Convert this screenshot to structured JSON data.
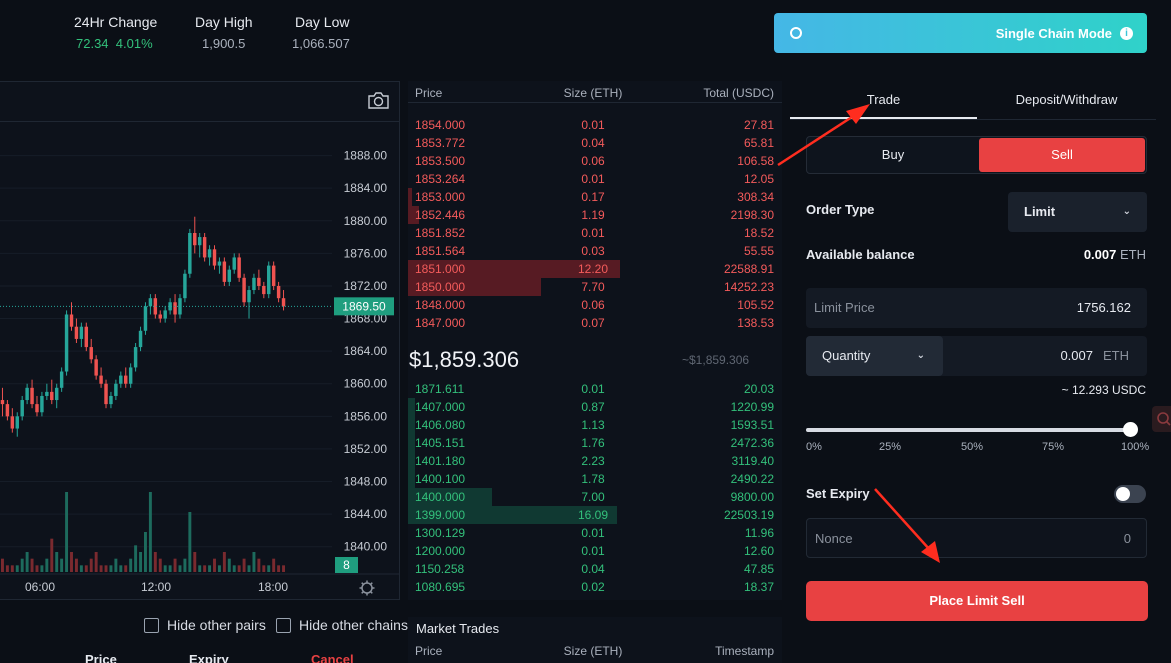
{
  "header": {
    "stats": [
      {
        "label": "24Hr Change",
        "value": "72.34",
        "extra": "4.01%"
      },
      {
        "label": "Day High",
        "value": "1,900.5"
      },
      {
        "label": "Day Low",
        "value": "1,066.507"
      }
    ],
    "mode_button": {
      "label": "Single Chain Mode",
      "info_glyph": "i",
      "ring_icon": "circle-ring-icon",
      "info_icon": "info-icon"
    }
  },
  "chart": {
    "toolbar_icon": "camera-icon",
    "last_price_label": "1869.50",
    "volume_badge": "8",
    "settings_icon": "gear-icon"
  },
  "chart_data": {
    "type": "candlestick",
    "ylim": [
      1838,
      1892
    ],
    "y_ticks": [
      "1888.00",
      "1884.00",
      "1880.00",
      "1876.00",
      "1872.00",
      "1868.00",
      "1864.00",
      "1860.00",
      "1856.00",
      "1852.00",
      "1848.00",
      "1844.00",
      "1840.00"
    ],
    "x_ticks": [
      "06:00",
      "12:00",
      "18:00"
    ],
    "last_price": 1869.5,
    "candles": [
      [
        1858.0,
        1859.5,
        1856.0,
        1857.5
      ],
      [
        1857.5,
        1858.0,
        1855.5,
        1856.0
      ],
      [
        1856.0,
        1857.0,
        1854.0,
        1854.5
      ],
      [
        1854.5,
        1856.5,
        1853.5,
        1856.0
      ],
      [
        1856.0,
        1858.5,
        1855.5,
        1858.0
      ],
      [
        1858.0,
        1860.0,
        1857.5,
        1859.5
      ],
      [
        1859.5,
        1860.5,
        1857.0,
        1857.5
      ],
      [
        1857.5,
        1858.5,
        1856.0,
        1856.5
      ],
      [
        1856.5,
        1859.0,
        1856.0,
        1858.5
      ],
      [
        1858.5,
        1860.0,
        1858.0,
        1859.0
      ],
      [
        1859.0,
        1860.5,
        1857.5,
        1858.0
      ],
      [
        1858.0,
        1860.0,
        1857.0,
        1859.5
      ],
      [
        1859.5,
        1862.0,
        1859.0,
        1861.5
      ],
      [
        1861.5,
        1869.0,
        1861.0,
        1868.5
      ],
      [
        1868.5,
        1870.0,
        1866.5,
        1867.0
      ],
      [
        1867.0,
        1868.0,
        1865.0,
        1865.5
      ],
      [
        1865.5,
        1867.5,
        1864.5,
        1867.0
      ],
      [
        1867.0,
        1867.5,
        1864.0,
        1864.5
      ],
      [
        1864.5,
        1865.5,
        1862.5,
        1863.0
      ],
      [
        1863.0,
        1863.5,
        1860.5,
        1861.0
      ],
      [
        1861.0,
        1862.0,
        1859.5,
        1860.0
      ],
      [
        1860.0,
        1860.5,
        1857.0,
        1857.5
      ],
      [
        1857.5,
        1859.0,
        1857.0,
        1858.5
      ],
      [
        1858.5,
        1860.5,
        1858.0,
        1860.0
      ],
      [
        1860.0,
        1861.5,
        1859.5,
        1861.0
      ],
      [
        1861.0,
        1862.0,
        1859.5,
        1860.0
      ],
      [
        1860.0,
        1862.5,
        1859.5,
        1862.0
      ],
      [
        1862.0,
        1865.0,
        1861.5,
        1864.5
      ],
      [
        1864.5,
        1867.0,
        1864.0,
        1866.5
      ],
      [
        1866.5,
        1870.0,
        1866.0,
        1869.5
      ],
      [
        1869.5,
        1871.0,
        1868.5,
        1870.5
      ],
      [
        1870.5,
        1871.0,
        1868.0,
        1868.5
      ],
      [
        1868.5,
        1869.0,
        1867.5,
        1868.0
      ],
      [
        1868.0,
        1869.5,
        1867.5,
        1869.0
      ],
      [
        1869.0,
        1870.5,
        1868.5,
        1870.0
      ],
      [
        1870.0,
        1871.0,
        1867.5,
        1868.5
      ],
      [
        1868.5,
        1871.0,
        1868.0,
        1870.5
      ],
      [
        1870.5,
        1874.0,
        1870.0,
        1873.5
      ],
      [
        1873.5,
        1879.0,
        1873.0,
        1878.5
      ],
      [
        1878.5,
        1880.5,
        1876.0,
        1877.0
      ],
      [
        1877.0,
        1878.5,
        1875.5,
        1878.0
      ],
      [
        1878.0,
        1878.5,
        1875.0,
        1875.5
      ],
      [
        1875.5,
        1877.0,
        1874.5,
        1876.5
      ],
      [
        1876.5,
        1877.0,
        1874.0,
        1874.5
      ],
      [
        1874.5,
        1875.5,
        1873.5,
        1875.0
      ],
      [
        1875.0,
        1875.5,
        1872.0,
        1872.5
      ],
      [
        1872.5,
        1874.5,
        1872.0,
        1874.0
      ],
      [
        1874.0,
        1876.0,
        1873.5,
        1875.5
      ],
      [
        1875.5,
        1876.0,
        1872.5,
        1873.0
      ],
      [
        1873.0,
        1873.5,
        1869.5,
        1870.0
      ],
      [
        1870.0,
        1872.0,
        1868.0,
        1871.5
      ],
      [
        1871.5,
        1873.5,
        1871.0,
        1873.0
      ],
      [
        1873.0,
        1874.0,
        1871.5,
        1872.0
      ],
      [
        1872.0,
        1872.5,
        1870.5,
        1871.0
      ],
      [
        1871.0,
        1875.0,
        1870.5,
        1874.5
      ],
      [
        1874.5,
        1875.0,
        1871.5,
        1872.0
      ],
      [
        1872.0,
        1872.5,
        1870.0,
        1870.5
      ],
      [
        1870.5,
        1871.5,
        1869.0,
        1869.5
      ]
    ],
    "volumes": [
      2,
      1,
      1,
      1,
      2,
      3,
      2,
      1,
      1,
      2,
      5,
      3,
      2,
      12,
      3,
      2,
      1,
      1,
      2,
      3,
      1,
      1,
      1,
      2,
      1,
      1,
      2,
      4,
      3,
      6,
      12,
      3,
      2,
      1,
      1,
      2,
      1,
      2,
      9,
      3,
      1,
      1,
      1,
      2,
      1,
      3,
      2,
      1,
      1,
      2,
      1,
      3,
      2,
      1,
      1,
      2,
      1,
      1
    ]
  },
  "order_book": {
    "headers": {
      "price": "Price",
      "size": "Size (ETH)",
      "total": "Total (USDC)"
    },
    "asks": [
      {
        "price": "1854.000",
        "size": "0.01",
        "total": "27.81",
        "depth": 0.0
      },
      {
        "price": "1853.772",
        "size": "0.04",
        "total": "65.81",
        "depth": 0.0
      },
      {
        "price": "1853.500",
        "size": "0.06",
        "total": "106.58",
        "depth": 0.0
      },
      {
        "price": "1853.264",
        "size": "0.01",
        "total": "12.05",
        "depth": 0.0
      },
      {
        "price": "1853.000",
        "size": "0.17",
        "total": "308.34",
        "depth": 0.01
      },
      {
        "price": "1852.446",
        "size": "1.19",
        "total": "2198.30",
        "depth": 0.03
      },
      {
        "price": "1851.852",
        "size": "0.01",
        "total": "18.52",
        "depth": 0.0
      },
      {
        "price": "1851.564",
        "size": "0.03",
        "total": "55.55",
        "depth": 0.0
      },
      {
        "price": "1851.000",
        "size": "12.20",
        "total": "22588.91",
        "depth": 0.566
      },
      {
        "price": "1850.000",
        "size": "7.70",
        "total": "14252.23",
        "depth": 0.356
      },
      {
        "price": "1848.000",
        "size": "0.06",
        "total": "105.52",
        "depth": 0.0
      },
      {
        "price": "1847.000",
        "size": "0.07",
        "total": "138.53",
        "depth": 0.0
      }
    ],
    "mid_price": "$1,859.306",
    "mid_sub": "~$1,859.306",
    "bids": [
      {
        "price": "1871.611",
        "size": "0.01",
        "total": "20.03",
        "depth": 0.0
      },
      {
        "price": "1407.000",
        "size": "0.87",
        "total": "1220.99",
        "depth": 0.02
      },
      {
        "price": "1406.080",
        "size": "1.13",
        "total": "1593.51",
        "depth": 0.02
      },
      {
        "price": "1405.151",
        "size": "1.76",
        "total": "2472.36",
        "depth": 0.02
      },
      {
        "price": "1401.180",
        "size": "2.23",
        "total": "3119.40",
        "depth": 0.02
      },
      {
        "price": "1400.100",
        "size": "1.78",
        "total": "2490.22",
        "depth": 0.02
      },
      {
        "price": "1400.000",
        "size": "7.00",
        "total": "9800.00",
        "depth": 0.225
      },
      {
        "price": "1399.000",
        "size": "16.09",
        "total": "22503.19",
        "depth": 0.56
      },
      {
        "price": "1300.129",
        "size": "0.01",
        "total": "11.96",
        "depth": 0.0
      },
      {
        "price": "1200.000",
        "size": "0.01",
        "total": "12.60",
        "depth": 0.0
      },
      {
        "price": "1150.258",
        "size": "0.04",
        "total": "47.85",
        "depth": 0.0
      },
      {
        "price": "1080.695",
        "size": "0.02",
        "total": "18.37",
        "depth": 0.0
      }
    ]
  },
  "market_trades": {
    "title": "Market Trades",
    "headers": {
      "price": "Price",
      "size": "Size (ETH)",
      "timestamp": "Timestamp"
    }
  },
  "filters": {
    "hide_pairs": "Hide other pairs",
    "hide_chains": "Hide other chains"
  },
  "orders_table": {
    "headers": [
      "Price",
      "Expiry",
      "Cancel"
    ]
  },
  "trade_panel": {
    "tabs": [
      "Trade",
      "Deposit/Withdraw"
    ],
    "buy": "Buy",
    "sell": "Sell",
    "order_type_label": "Order Type",
    "order_type_value": "Limit",
    "balance_label": "Available balance",
    "balance_value": "0.007",
    "balance_unit": "ETH",
    "limit_price_label": "Limit Price",
    "limit_price_value": "1756.162",
    "quantity_label": "Quantity",
    "quantity_value": "0.007",
    "quantity_unit": "ETH",
    "approx_value": "~ 12.293 USDC",
    "slider_percent": 100,
    "slider_labels": [
      "0%",
      "25%",
      "50%",
      "75%",
      "100%"
    ],
    "set_expiry_label": "Set Expiry",
    "nonce_label": "Nonce",
    "nonce_value": "0",
    "place_button": "Place Limit Sell",
    "chevron_glyph": "⌄"
  },
  "colors": {
    "accent_red": "#e84142",
    "accent_green": "#33c07b",
    "mode_gradient": [
      "#45b7e6",
      "#2fd2c9"
    ]
  }
}
